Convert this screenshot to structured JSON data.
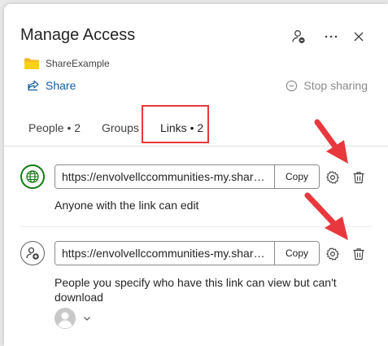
{
  "dialog": {
    "title": "Manage Access",
    "folder_name": "ShareExample",
    "share_label": "Share",
    "stop_sharing_label": "Stop sharing"
  },
  "tabs": [
    {
      "label": "People • 2"
    },
    {
      "label": "Groups"
    },
    {
      "label": "Links • 2",
      "active": true
    }
  ],
  "links": [
    {
      "url": "https://envolvellccommunities-my.sharepoint.com",
      "copy_label": "Copy",
      "description": "Anyone with the link can edit",
      "icon": "globe-icon"
    },
    {
      "url": "https://envolvellccommunities-my.sharepoint.com",
      "copy_label": "Copy",
      "description": "People you specify who have this link can view but can't download",
      "icon": "person-add-icon"
    }
  ],
  "colors": {
    "accent": "#0f6cbd",
    "link_text": "#115ea3",
    "annotation_red": "#e8383e",
    "globe_green": "#107c10"
  }
}
